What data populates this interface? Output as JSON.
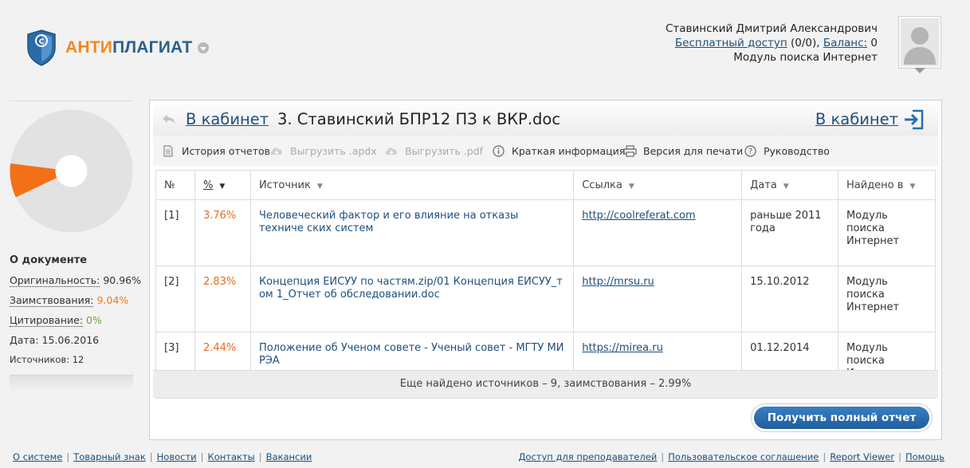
{
  "brand": {
    "part1": "АНТИ",
    "part2": "ПЛАГИАТ"
  },
  "colors": {
    "accent_orange": "#f08a1c",
    "brand_blue": "#2b5f91",
    "borrowed": "#f07a1a",
    "cited": "#6fa832"
  },
  "user": {
    "name": "Ставинский Дмитрий Александрович",
    "access_link": "Бесплатный доступ",
    "access_counts": "(0/0),",
    "balance_label": "Баланс:",
    "balance_value": "0",
    "module": "Модуль поиска Интернет"
  },
  "sidebar": {
    "title": "О документе",
    "originality_label": "Оригинальность:",
    "originality_value": "90.96%",
    "borrowing_label": "Заимствования:",
    "borrowing_value": "9.04%",
    "citation_label": "Цитирование:",
    "citation_value": "0%",
    "date_text": "Дата: 15.06.2016",
    "sources_text": "Источников: 12"
  },
  "chart_data": {
    "type": "pie",
    "slices": [
      {
        "label": "Оригинальность",
        "value": 90.96,
        "color": "#e2e2e2"
      },
      {
        "label": "Заимствования",
        "value": 9.04,
        "color": "#f37019"
      },
      {
        "label": "Цитирование",
        "value": 0,
        "color": "#6fa832"
      }
    ]
  },
  "report": {
    "back_label": "В кабинет",
    "doc_title": "3. Ставинский БПР12 ПЗ к ВКР.doc",
    "back_right_label": "В кабинет"
  },
  "toolbar": [
    {
      "label": "История отчетов",
      "icon": "document-icon",
      "enabled": true
    },
    {
      "label": "Выгрузить .apdx",
      "icon": "cloud-download-icon",
      "enabled": false
    },
    {
      "label": "Выгрузить .pdf",
      "icon": "cloud-download-icon",
      "enabled": false
    },
    {
      "label": "Краткая информация",
      "icon": "info-icon",
      "enabled": true
    },
    {
      "label": "Версия для печати",
      "icon": "printer-icon",
      "enabled": true
    },
    {
      "label": "Руководство",
      "icon": "help-icon",
      "enabled": true
    }
  ],
  "table": {
    "headers": {
      "num": "№",
      "pct": "%",
      "source": "Источник",
      "link": "Ссылка",
      "date": "Дата",
      "found": "Найдено в"
    },
    "rows": [
      {
        "num": "[1]",
        "pct": "3.76%",
        "source": "Человеческий фактор и его влияние на отказы техниче ских систем",
        "link": "http://coolreferat.com",
        "date": "раньше 2011 года",
        "found": "Модуль поиска Интернет"
      },
      {
        "num": "[2]",
        "pct": "2.83%",
        "source": "Концепция ЕИСУУ по частям.zip/01 Концепция ЕИСУУ_т ом 1_Отчет об обследовании.doc",
        "link": "http://mrsu.ru",
        "date": "15.10.2012",
        "found": "Модуль поиска Интернет"
      },
      {
        "num": "[3]",
        "pct": "2.44%",
        "source": "Положение об Ученом совете - Ученый совет - МГТУ МИ РЭА",
        "link": "https://mirea.ru",
        "date": "01.12.2014",
        "found": "Модуль поиска Интернет"
      }
    ],
    "more_text": "Еще найдено источников – 9, заимствования – 2.99%"
  },
  "full_report_button": "Получить полный отчет",
  "footer": {
    "left": [
      "О системе",
      "Товарный знак",
      "Новости",
      "Контакты",
      "Вакансии"
    ],
    "right": [
      "Доступ для преподавателей",
      "Пользовательское соглашение",
      "Report Viewer",
      "Помощь"
    ]
  }
}
